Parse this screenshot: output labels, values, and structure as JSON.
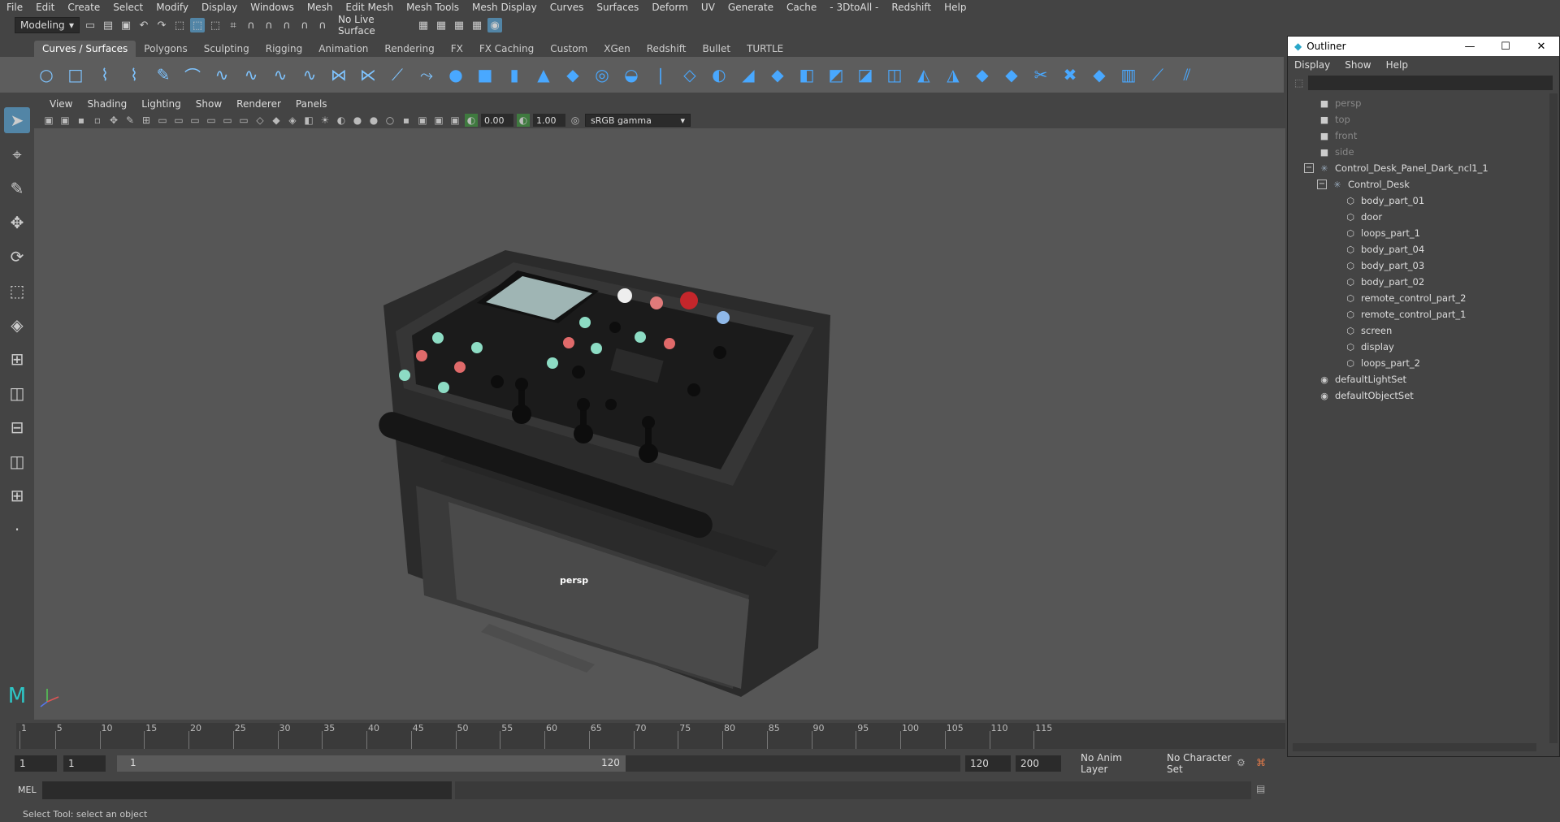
{
  "menubar": [
    "File",
    "Edit",
    "Create",
    "Select",
    "Modify",
    "Display",
    "Windows",
    "Mesh",
    "Edit Mesh",
    "Mesh Tools",
    "Mesh Display",
    "Curves",
    "Surfaces",
    "Deform",
    "UV",
    "Generate",
    "Cache",
    "- 3DtoAll -",
    "Redshift",
    "Help"
  ],
  "status": {
    "mode": "Modeling",
    "live_surface": "No Live Surface"
  },
  "shelf_tabs": [
    "Curves / Surfaces",
    "Polygons",
    "Sculpting",
    "Rigging",
    "Animation",
    "Rendering",
    "FX",
    "FX Caching",
    "Custom",
    "XGen",
    "Redshift",
    "Bullet",
    "TURTLE"
  ],
  "shelf_tab_active": "Curves / Surfaces",
  "panel_menu": [
    "View",
    "Shading",
    "Lighting",
    "Show",
    "Renderer",
    "Panels"
  ],
  "panel_toolbar": {
    "exposure": "0.00",
    "gamma": "1.00",
    "color_space": "sRGB gamma"
  },
  "viewport": {
    "camera_label": "persp"
  },
  "timeline": {
    "ticks": [
      "1",
      "5",
      "10",
      "15",
      "20",
      "25",
      "30",
      "35",
      "40",
      "45",
      "50",
      "55",
      "60",
      "65",
      "70",
      "75",
      "80",
      "85",
      "90",
      "95",
      "100",
      "105",
      "110",
      "115"
    ],
    "current": "1"
  },
  "range": {
    "start": "1",
    "playback_start": "1",
    "slider_start": "1",
    "slider_end": "120",
    "playback_end": "120",
    "end": "200",
    "anim_layer": "No Anim Layer",
    "char_set": "No Character Set"
  },
  "mel": {
    "label": "MEL"
  },
  "help_line": "Select Tool: select an object",
  "outliner": {
    "title": "Outliner",
    "menu": [
      "Display",
      "Show",
      "Help"
    ],
    "items": [
      {
        "label": "persp",
        "depth": 0,
        "icon": "camera-icon",
        "dim": true
      },
      {
        "label": "top",
        "depth": 0,
        "icon": "camera-icon",
        "dim": true
      },
      {
        "label": "front",
        "depth": 0,
        "icon": "camera-icon",
        "dim": true
      },
      {
        "label": "side",
        "depth": 0,
        "icon": "camera-icon",
        "dim": true
      },
      {
        "label": "Control_Desk_Panel_Dark_ncl1_1",
        "depth": 0,
        "icon": "group-icon",
        "expand": "minus"
      },
      {
        "label": "Control_Desk",
        "depth": 1,
        "icon": "group-icon",
        "expand": "minus"
      },
      {
        "label": "body_part_01",
        "depth": 2,
        "icon": "mesh-icon"
      },
      {
        "label": "door",
        "depth": 2,
        "icon": "mesh-icon"
      },
      {
        "label": "loops_part_1",
        "depth": 2,
        "icon": "mesh-icon"
      },
      {
        "label": "body_part_04",
        "depth": 2,
        "icon": "mesh-icon"
      },
      {
        "label": "body_part_03",
        "depth": 2,
        "icon": "mesh-icon"
      },
      {
        "label": "body_part_02",
        "depth": 2,
        "icon": "mesh-icon"
      },
      {
        "label": "remote_control_part_2",
        "depth": 2,
        "icon": "mesh-icon"
      },
      {
        "label": "remote_control_part_1",
        "depth": 2,
        "icon": "mesh-icon"
      },
      {
        "label": "screen",
        "depth": 2,
        "icon": "mesh-icon"
      },
      {
        "label": "display",
        "depth": 2,
        "icon": "mesh-icon"
      },
      {
        "label": "loops_part_2",
        "depth": 2,
        "icon": "mesh-icon"
      },
      {
        "label": "defaultLightSet",
        "depth": 0,
        "icon": "set-icon"
      },
      {
        "label": "defaultObjectSet",
        "depth": 0,
        "icon": "set-icon"
      }
    ]
  },
  "colors": {
    "accent": "#5285a6",
    "viewport_bg": "#565656",
    "shelf_bg": "#5d5d5d"
  }
}
